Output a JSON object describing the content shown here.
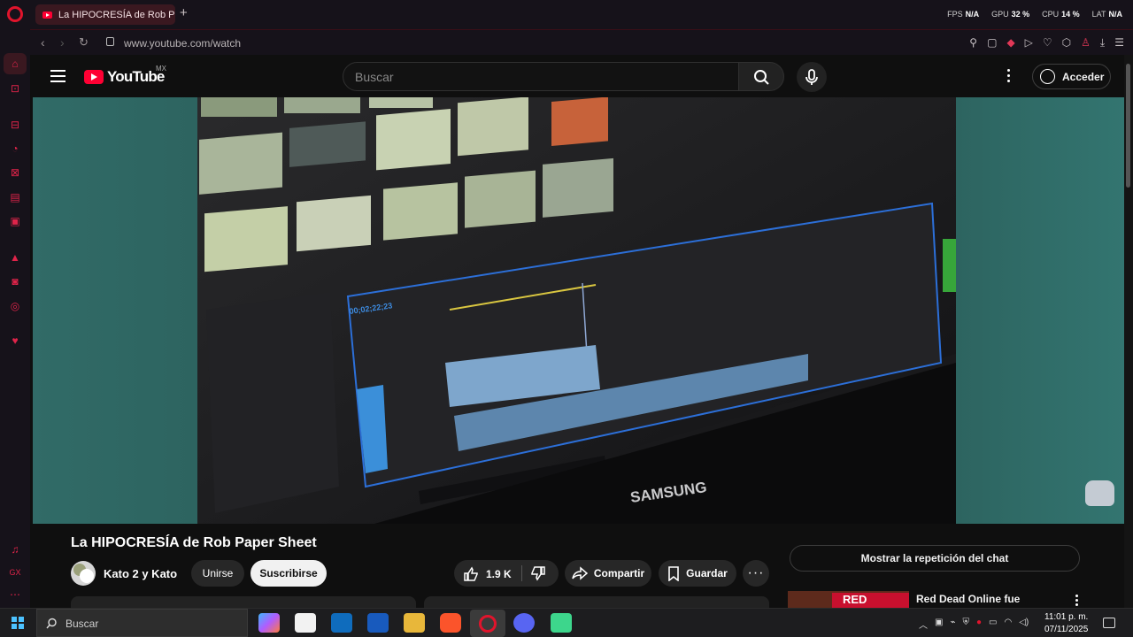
{
  "browser": {
    "tab_title": "La HIPOCRESÍA de Rob Paper Sheet",
    "new_tab_symbol": "+",
    "url": "www.youtube.com/watch",
    "stats": [
      {
        "label": "FPS",
        "value": "N/A"
      },
      {
        "label": "GPU",
        "value": "32 %"
      },
      {
        "label": "CPU",
        "value": "14 %"
      },
      {
        "label": "LAT",
        "value": "N/A"
      }
    ]
  },
  "youtube": {
    "logo_text": "YouTube",
    "country_code": "MX",
    "search_placeholder": "Buscar",
    "signin_label": "Acceder",
    "video": {
      "title": "La HIPOCRESÍA de Rob Paper Sheet",
      "monitor_brand": "SAMSUNG",
      "timecode": "00;02;22;23"
    },
    "channel": {
      "name": "Kato 2 y Kato",
      "join_label": "Unirse",
      "subscribe_label": "Suscribirse"
    },
    "actions": {
      "likes": "1.9 K",
      "share_label": "Compartir",
      "save_label": "Guardar"
    },
    "chat_replay_label": "Mostrar la repetición del chat",
    "recommended": {
      "title": "Red Dead Online fue",
      "thumb_text": "RED"
    }
  },
  "taskbar": {
    "search_placeholder": "Buscar",
    "time": "11:01 p. m.",
    "date": "07/11/2025"
  },
  "colors": {
    "accent": "#e0244a",
    "youtube_red": "#ff0033",
    "background": "#0f0f0f",
    "player_side": "#2f6e68"
  }
}
